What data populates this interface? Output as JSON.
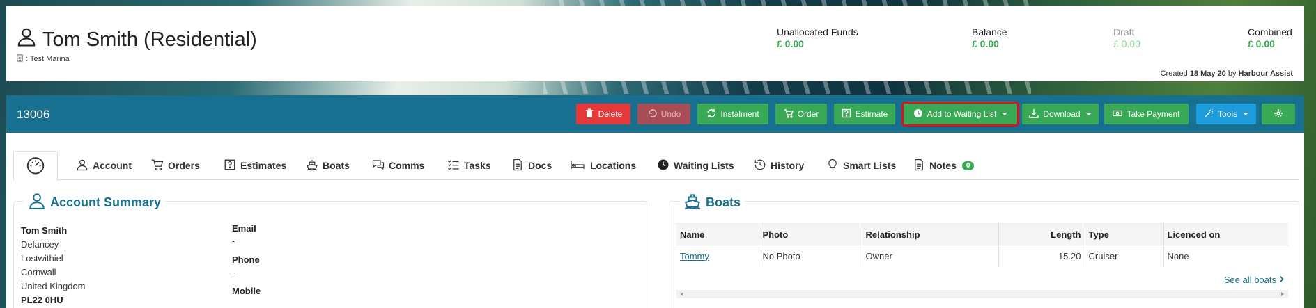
{
  "header": {
    "account_name": "Tom Smith (Residential)",
    "marina_label": ": Test Marina",
    "funds": [
      {
        "label": "Unallocated Funds",
        "value": "£ 0.00"
      },
      {
        "label": "Balance",
        "value": "£ 0.00"
      },
      {
        "label": "Draft",
        "value": "£ 0.00"
      },
      {
        "label": "Combined",
        "value": "£ 0.00"
      }
    ],
    "created_prefix": "Created",
    "created_date": "18 May 20",
    "created_by_prefix": "by",
    "created_by": "Harbour Assist"
  },
  "toolbar": {
    "account_number": "13006",
    "delete": "Delete",
    "undo": "Undo",
    "instalment": "Instalment",
    "order": "Order",
    "estimate": "Estimate",
    "add_waiting_list": "Add to Waiting List",
    "download": "Download",
    "take_payment": "Take Payment",
    "tools": "Tools"
  },
  "tabs": {
    "account": "Account",
    "orders": "Orders",
    "estimates": "Estimates",
    "boats": "Boats",
    "comms": "Comms",
    "tasks": "Tasks",
    "docs": "Docs",
    "locations": "Locations",
    "waiting_lists": "Waiting Lists",
    "history": "History",
    "smart_lists": "Smart Lists",
    "notes": "Notes",
    "notes_count": "0"
  },
  "account_summary": {
    "title": "Account Summary",
    "name": "Tom Smith",
    "address_lines": [
      "Delancey",
      "Lostwithiel",
      "Cornwall",
      "United Kingdom"
    ],
    "postcode": "PL22 0HU",
    "email_label": "Email",
    "email_value": "-",
    "phone_label": "Phone",
    "phone_value": "-",
    "mobile_label": "Mobile"
  },
  "boats_panel": {
    "title": "Boats",
    "columns": [
      "Name",
      "Photo",
      "Relationship",
      "Length",
      "Type",
      "Licenced on"
    ],
    "rows": [
      {
        "name": "Tommy",
        "photo": "No Photo",
        "relationship": "Owner",
        "length": "15.20",
        "type": "Cruiser",
        "licenced_on": "None"
      }
    ],
    "see_all": "See all boats"
  },
  "colors": {
    "brand_blue": "#17708f",
    "green": "#3aa956",
    "red": "#e53838",
    "highlight": "#d7141f"
  }
}
